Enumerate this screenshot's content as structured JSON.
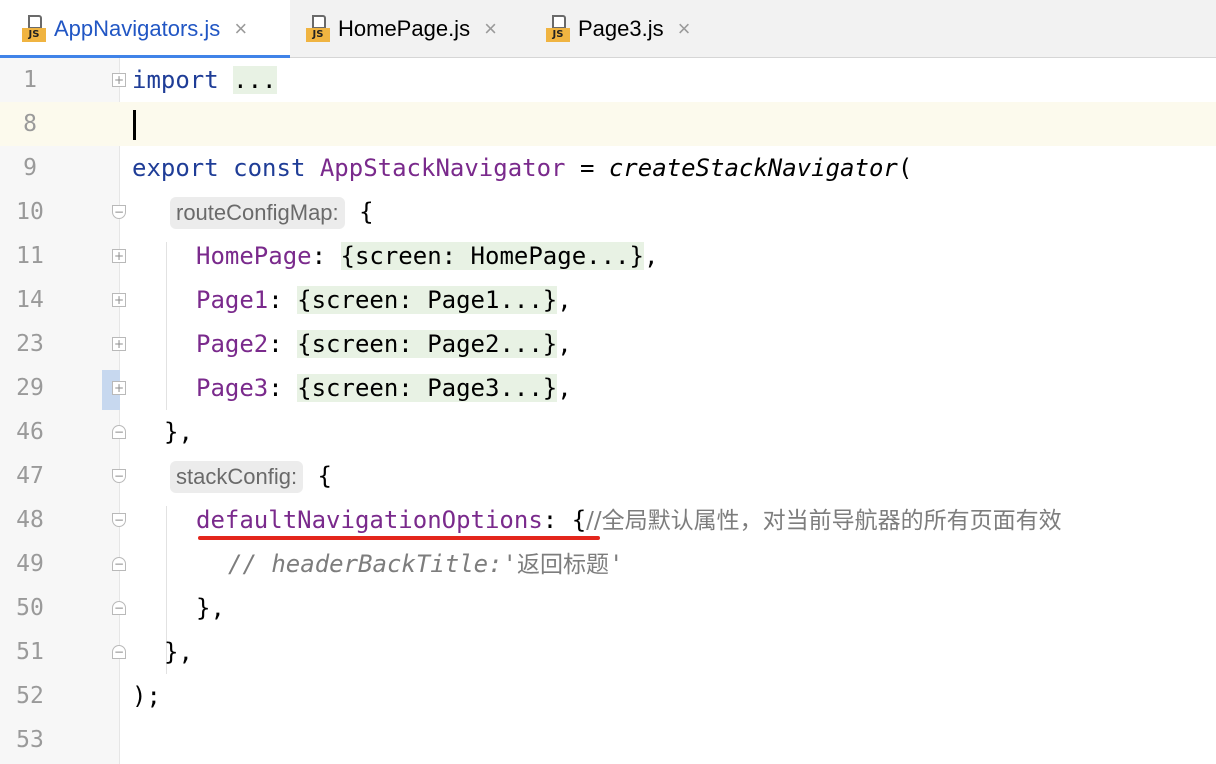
{
  "tabs": [
    {
      "title": "AppNavigators.js",
      "icon": "js-file-icon",
      "close": "×",
      "active": true
    },
    {
      "title": "HomePage.js",
      "icon": "js-file-icon",
      "close": "×",
      "active": false
    },
    {
      "title": "Page3.js",
      "icon": "js-file-icon",
      "close": "×",
      "active": false
    }
  ],
  "icon_badge": "JS",
  "lines": [
    {
      "num": "1",
      "parts": [
        "import",
        " ",
        "..."
      ]
    },
    {
      "num": "8",
      "parts": []
    },
    {
      "num": "9",
      "parts": [
        "export",
        " ",
        "const",
        " ",
        "AppStackNavigator",
        " = ",
        "createStackNavigator",
        "("
      ]
    },
    {
      "num": "10",
      "parts": [
        "routeConfigMap:",
        " {"
      ]
    },
    {
      "num": "11",
      "parts": [
        "HomePage",
        ": ",
        "{screen: HomePage...}",
        ","
      ]
    },
    {
      "num": "14",
      "parts": [
        "Page1",
        ": ",
        "{screen: Page1...}",
        ","
      ]
    },
    {
      "num": "23",
      "parts": [
        "Page2",
        ": ",
        "{screen: Page2...}",
        ","
      ]
    },
    {
      "num": "29",
      "parts": [
        "Page3",
        ": ",
        "{screen: Page3...}",
        ","
      ]
    },
    {
      "num": "46",
      "parts": [
        "},"
      ]
    },
    {
      "num": "47",
      "parts": [
        "stackConfig:",
        " {"
      ]
    },
    {
      "num": "48",
      "parts": [
        "defaultNavigationOptions",
        ": ",
        "{",
        "//全局默认属性，对当前导航器的所有页面有效"
      ]
    },
    {
      "num": "49",
      "parts": [
        "// headerBackTitle:'",
        "返回标题",
        "'"
      ]
    },
    {
      "num": "50",
      "parts": [
        "},"
      ]
    },
    {
      "num": "51",
      "parts": [
        "},"
      ]
    },
    {
      "num": "52",
      "parts": [
        ");"
      ]
    },
    {
      "num": "53",
      "parts": []
    }
  ],
  "colors": {
    "keyword": "#1f3d97",
    "identifier": "#7a2a8c",
    "folded_bg": "#e8f2e4",
    "current_line": "#fcfaed",
    "underline": "#e3261c"
  }
}
